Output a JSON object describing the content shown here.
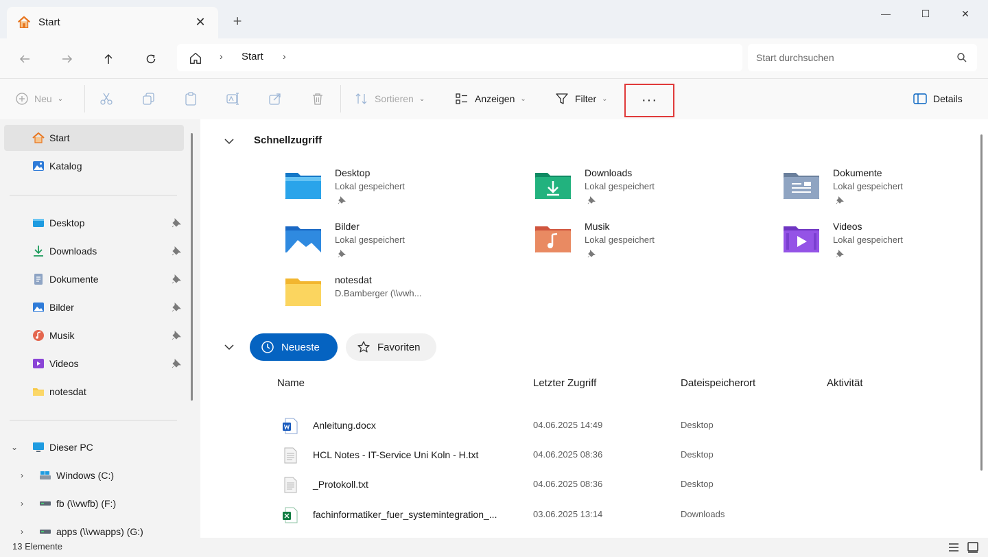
{
  "window": {
    "tab_title": "Start",
    "new_tab": "+",
    "minimize": "—",
    "maximize": "☐",
    "close": "✕"
  },
  "address": {
    "breadcrumb": "Start",
    "search_placeholder": "Start durchsuchen"
  },
  "commands": {
    "new": "Neu",
    "sort": "Sortieren",
    "view": "Anzeigen",
    "filter": "Filter",
    "more": "···",
    "details": "Details"
  },
  "sidebar": {
    "top": [
      {
        "label": "Start",
        "icon": "home-icon"
      },
      {
        "label": "Katalog",
        "icon": "gallery-icon"
      }
    ],
    "pinned": [
      {
        "label": "Desktop",
        "icon": "desktop-icon"
      },
      {
        "label": "Downloads",
        "icon": "downloads-icon"
      },
      {
        "label": "Dokumente",
        "icon": "documents-icon"
      },
      {
        "label": "Bilder",
        "icon": "pictures-icon"
      },
      {
        "label": "Musik",
        "icon": "music-icon"
      },
      {
        "label": "Videos",
        "icon": "videos-icon"
      },
      {
        "label": "notesdat",
        "icon": "folder-icon"
      }
    ],
    "tree": [
      {
        "label": "Dieser PC",
        "icon": "pc-icon"
      },
      {
        "label": "Windows (C:)",
        "icon": "drive-icon"
      },
      {
        "label": "fb (\\\\vwfb) (F:)",
        "icon": "network-drive-icon"
      },
      {
        "label": "apps (\\\\vwapps) (G:)",
        "icon": "network-drive-icon"
      }
    ]
  },
  "quick_access": {
    "title": "Schnellzugriff",
    "items": [
      {
        "name": "Desktop",
        "sub": "Lokal gespeichert"
      },
      {
        "name": "Downloads",
        "sub": "Lokal gespeichert"
      },
      {
        "name": "Dokumente",
        "sub": "Lokal gespeichert"
      },
      {
        "name": "Bilder",
        "sub": "Lokal gespeichert"
      },
      {
        "name": "Musik",
        "sub": "Lokal gespeichert"
      },
      {
        "name": "Videos",
        "sub": "Lokal gespeichert"
      },
      {
        "name": "notesdat",
        "sub": "D.Bamberger (\\\\vwh..."
      }
    ]
  },
  "recent": {
    "tab_recent": "Neueste",
    "tab_favorites": "Favoriten",
    "columns": [
      "Name",
      "Letzter Zugriff",
      "Dateispeicherort",
      "Aktivität"
    ],
    "rows": [
      {
        "name": "Anleitung.docx",
        "date": "04.06.2025 14:49",
        "location": "Desktop",
        "icon": "word-file-icon"
      },
      {
        "name": "HCL Notes - IT-Service Uni Koln - H.txt",
        "date": "04.06.2025 08:36",
        "location": "Desktop",
        "icon": "text-file-icon"
      },
      {
        "name": "_Protokoll.txt",
        "date": "04.06.2025 08:36",
        "location": "Desktop",
        "icon": "text-file-icon"
      },
      {
        "name": "fachinformatiker_fuer_systemintegration_...",
        "date": "03.06.2025 13:14",
        "location": "Downloads",
        "icon": "excel-file-icon"
      }
    ]
  },
  "status": {
    "count": "13 Elemente"
  },
  "colors": {
    "accent": "#0563c1",
    "highlight_border": "#e03a3a"
  }
}
